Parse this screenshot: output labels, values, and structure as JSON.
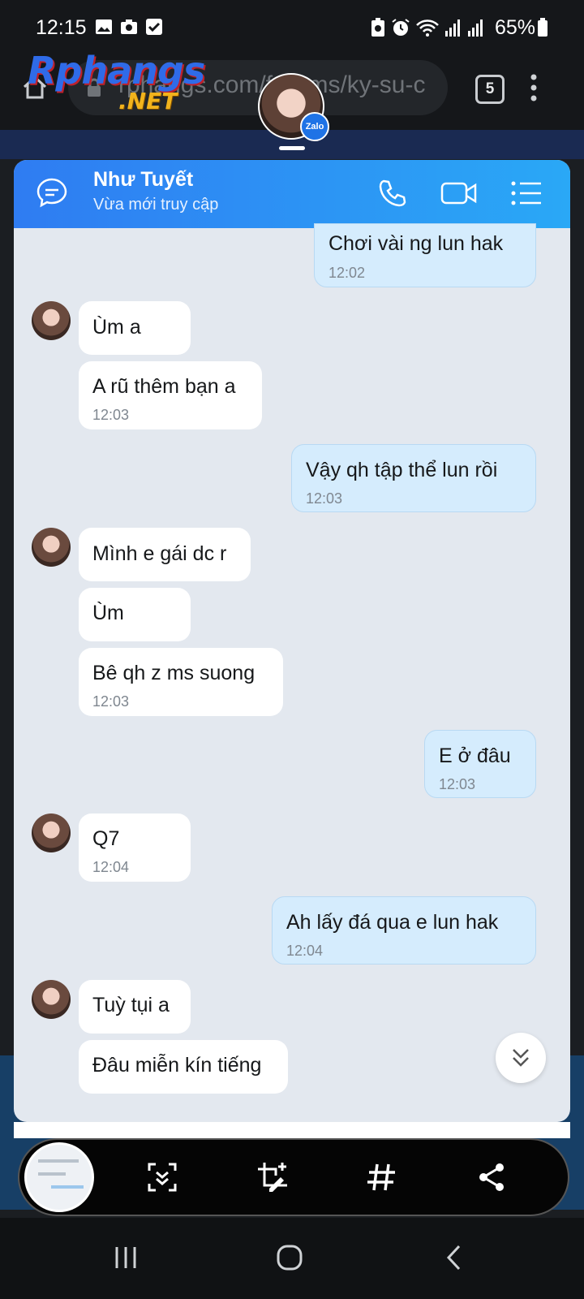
{
  "status_bar": {
    "time": "12:15",
    "battery": "65%"
  },
  "browser": {
    "url": "rphangs.com/forums/ky-su-c",
    "tab_count": "5",
    "logo_main": "Rphangs",
    "logo_sub": ".NET"
  },
  "floating_chat": {
    "badge": "Zalo"
  },
  "chat": {
    "contact_name": "Như Tuyết",
    "contact_status": "Vừa mới truy cập",
    "messages": [
      {
        "side": "out",
        "text": "Chơi  vài  ng lun hak",
        "time": "12:02"
      },
      {
        "side": "in",
        "text": "Ùm a",
        "time": ""
      },
      {
        "side": "in",
        "text": "A rũ thêm bạn a",
        "time": "12:03"
      },
      {
        "side": "out",
        "text": "Vậy qh tập thể  lun rồi",
        "time": "12:03"
      },
      {
        "side": "in",
        "text": "Mình e gái dc r",
        "time": ""
      },
      {
        "side": "in",
        "text": "Ùm",
        "time": ""
      },
      {
        "side": "in",
        "text": "Bê qh z ms suong",
        "time": "12:03"
      },
      {
        "side": "out",
        "text": "E ở  đâu",
        "time": "12:03"
      },
      {
        "side": "in",
        "text": "Q7",
        "time": "12:04"
      },
      {
        "side": "out",
        "text": "Ah lấy  đá  qua e lun hak",
        "time": "12:04"
      },
      {
        "side": "in",
        "text": "Tuỳ tụi a",
        "time": ""
      },
      {
        "side": "in",
        "text": "Đâu miễn kín tiếng",
        "time": ""
      }
    ]
  },
  "screenshot_toolbar": {
    "tools": [
      "scroll-capture",
      "crop-draw",
      "tag",
      "share"
    ]
  },
  "colors": {
    "header_start": "#2f7cf2",
    "header_end": "#2aa8f6",
    "incoming_bubble": "#ffffff",
    "outgoing_bubble": "#d5ecfd",
    "chat_bg": "#e3e8ef"
  }
}
